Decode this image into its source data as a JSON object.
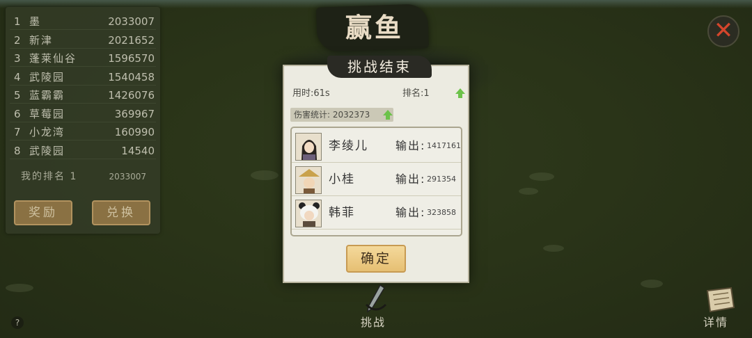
{
  "banner": {
    "title": "赢鱼"
  },
  "ranking": {
    "rows": [
      {
        "index": "1",
        "name": "墨",
        "score": "2033007"
      },
      {
        "index": "2",
        "name": "新津",
        "score": "2021652"
      },
      {
        "index": "3",
        "name": "蓬莱仙谷",
        "score": "1596570"
      },
      {
        "index": "4",
        "name": "武陵园",
        "score": "1540458"
      },
      {
        "index": "5",
        "name": "蓝霸霸",
        "score": "1426076"
      },
      {
        "index": "6",
        "name": "草莓园",
        "score": "369967"
      },
      {
        "index": "7",
        "name": "小龙湾",
        "score": "160990"
      },
      {
        "index": "8",
        "name": "武陵园",
        "score": "14540"
      }
    ],
    "my_rank_label": "我的排名 1",
    "my_rank_score": "2033007",
    "reward_button": "奖励",
    "exchange_button": "兑换"
  },
  "dialog": {
    "title": "挑战结束",
    "time_label": "用时:61s",
    "rank_label": "排名:1",
    "damage_label": "伤害统计: 2032373",
    "output_label": "输出:",
    "members": [
      {
        "name": "李绫儿",
        "output": "1417161",
        "avatar": "girl-portrait-icon"
      },
      {
        "name": "小桂",
        "output": "291354",
        "avatar": "straw-hat-boy-portrait-icon"
      },
      {
        "name": "韩菲",
        "output": "323858",
        "avatar": "panda-hood-girl-portrait-icon"
      }
    ],
    "confirm_button": "确定"
  },
  "bottom": {
    "challenge_label": "挑战",
    "details_label": "详情",
    "help_label": "?"
  },
  "colors": {
    "accent_green": "#6cc24a",
    "close_red": "#d4452c",
    "confirm_gold": "#e6bf73"
  }
}
